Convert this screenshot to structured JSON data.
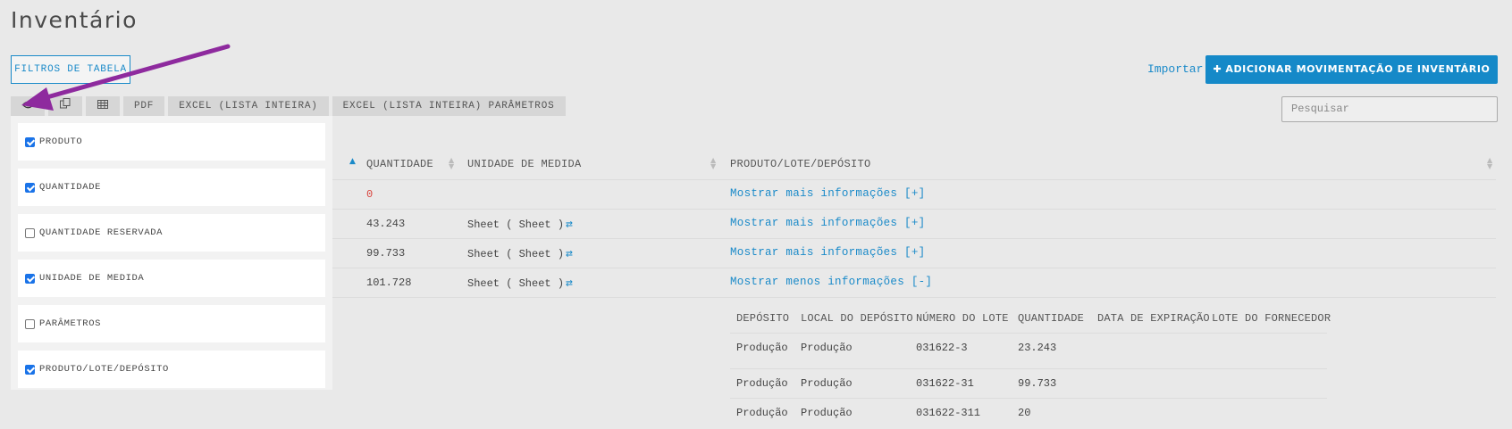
{
  "page": {
    "title": "Inventário"
  },
  "actions": {
    "filters_label": "FILTROS DE TABELA",
    "import_label": "Importar",
    "add_icon": "plus-icon",
    "add_label": "ADICIONAR MOVIMENTAÇÃO DE INVENTÁRIO"
  },
  "toolbar": {
    "eye_icon": "eye-icon",
    "copy_icon": "copy-icon",
    "table_icon": "table-icon",
    "pdf_label": "PDF",
    "excel_label": "EXCEL (LISTA INTEIRA)",
    "excel_params_label": "EXCEL (LISTA INTEIRA) PARÂMETROS"
  },
  "search": {
    "placeholder": "Pesquisar"
  },
  "column_picker": [
    {
      "label": "PRODUTO",
      "checked": true
    },
    {
      "label": "QUANTIDADE",
      "checked": true
    },
    {
      "label": "QUANTIDADE RESERVADA",
      "checked": false
    },
    {
      "label": "UNIDADE DE MEDIDA",
      "checked": true
    },
    {
      "label": "PARÂMETROS",
      "checked": false
    },
    {
      "label": "PRODUTO/LOTE/DEPÓSITO",
      "checked": true
    }
  ],
  "table": {
    "headers": [
      "QUANTIDADE",
      "UNIDADE DE MEDIDA",
      "PRODUTO/LOTE/DEPÓSITO"
    ],
    "rows": [
      {
        "quantity": "0",
        "unit": "",
        "link": "Mostrar mais informações [+]"
      },
      {
        "quantity": "43.243",
        "unit": "Sheet ( Sheet )",
        "link": "Mostrar mais informações [+]"
      },
      {
        "quantity": "99.733",
        "unit": "Sheet ( Sheet )",
        "link": "Mostrar mais informações [+]"
      },
      {
        "quantity": "101.728",
        "unit": "Sheet ( Sheet )",
        "link": "Mostrar menos informações [-]"
      }
    ]
  },
  "subtable": {
    "headers": [
      "DEPÓSITO",
      "LOCAL DO DEPÓSITO",
      "NÚMERO DO LOTE",
      "QUANTIDADE",
      "DATA DE EXPIRAÇÃO",
      "LOTE DO FORNECEDOR"
    ],
    "rows": [
      [
        "Produção",
        "Produção",
        "031622-3",
        "23.243"
      ],
      [
        "Produção",
        "Produção",
        "031622-31",
        "99.733"
      ],
      [
        "Produção",
        "Produção",
        "031622-311",
        "20"
      ]
    ]
  },
  "colors": {
    "accent": "#1589c8",
    "link": "#1a8ac9",
    "negative": "#d9443d",
    "annotation_arrow": "#8e2a9e"
  },
  "annotation": {
    "arrow_icon": "annotation-arrow-icon"
  }
}
